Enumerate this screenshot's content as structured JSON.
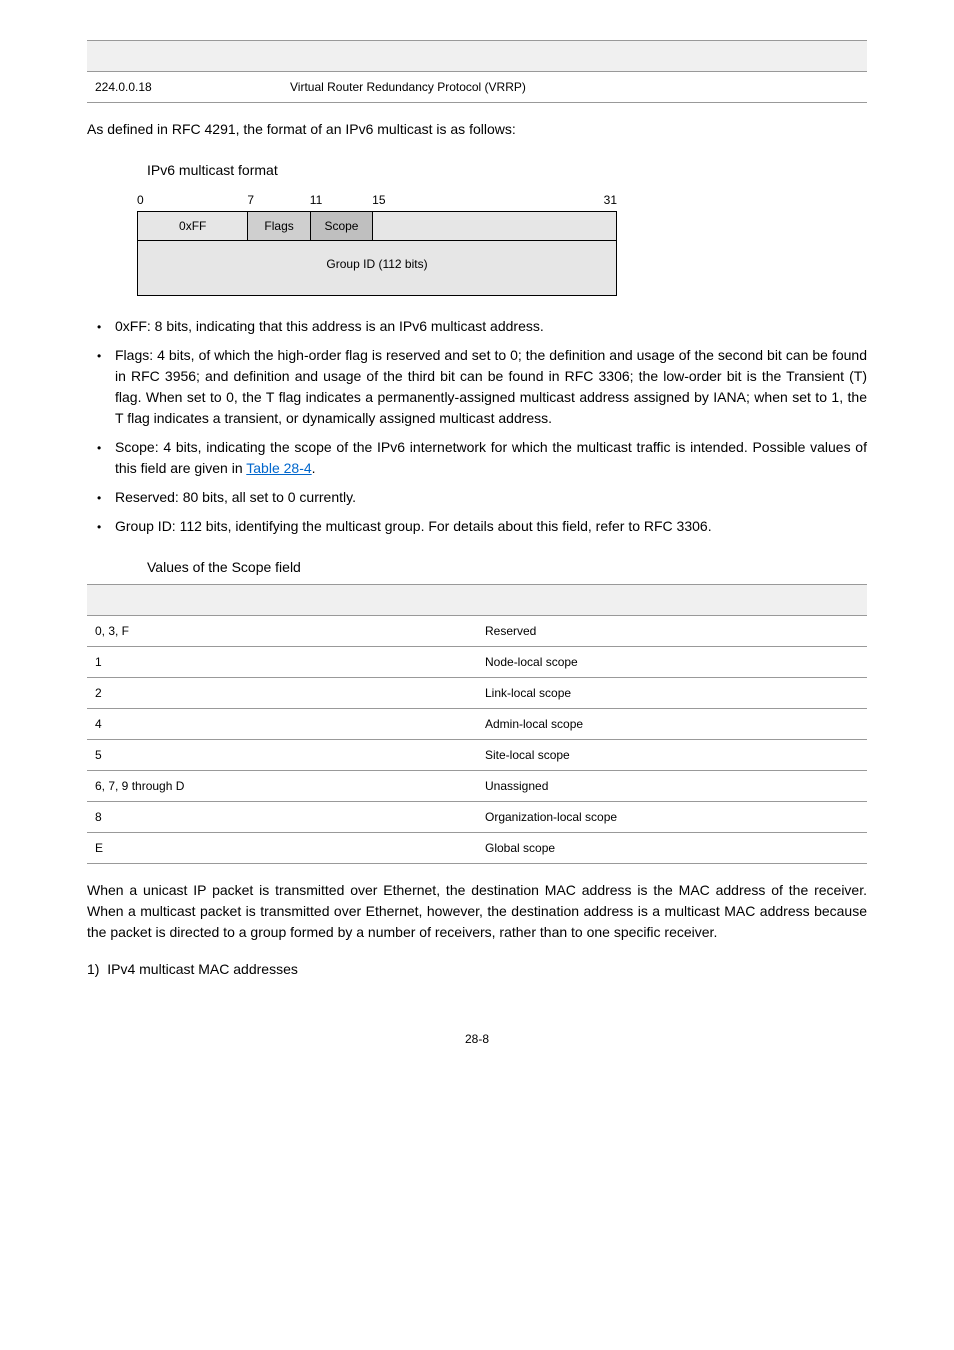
{
  "top_table": {
    "col1": "224.0.0.18",
    "col2": "Virtual Router Redundancy Protocol (VRRP)"
  },
  "intro": "As defined in RFC 4291, the format of an IPv6 multicast is as follows:",
  "diagram_caption": "IPv6 multicast format",
  "diagram": {
    "bits": {
      "b0": "0",
      "b7": "7",
      "b11": "11",
      "b15": "15",
      "b31": "31"
    },
    "ff": "0xFF",
    "flags": "Flags",
    "scope": "Scope",
    "group": "Group ID (112 bits)"
  },
  "bullets": [
    "0xFF: 8 bits, indicating that this address is an IPv6 multicast address.",
    "Flags: 4 bits, of which the high-order flag is reserved and set to 0; the definition and usage of the second bit can be found in RFC 3956; and definition and usage of the third bit can be found in RFC 3306; the low-order bit is the Transient (T) flag. When set to 0, the T flag indicates a permanently-assigned multicast address assigned by IANA; when set to 1, the T flag indicates a transient, or dynamically assigned multicast address.",
    "Scope: 4 bits, indicating the scope of the IPv6 internetwork for which the multicast traffic is intended. Possible values of this field are given in ",
    "Reserved: 80 bits, all set to 0 currently.",
    "Group ID: 112 bits, identifying the multicast group. For details about this field, refer to RFC 3306."
  ],
  "table_ref": "Table 28-4",
  "scope_caption": "Values of the Scope field",
  "scope_table": [
    {
      "v": "0, 3, F",
      "m": "Reserved"
    },
    {
      "v": "1",
      "m": "Node-local scope"
    },
    {
      "v": "2",
      "m": "Link-local scope"
    },
    {
      "v": "4",
      "m": "Admin-local scope"
    },
    {
      "v": "5",
      "m": "Site-local scope"
    },
    {
      "v": "6, 7, 9 through D",
      "m": "Unassigned"
    },
    {
      "v": "8",
      "m": "Organization-local scope"
    },
    {
      "v": "E",
      "m": "Global scope"
    }
  ],
  "para2": "When a unicast IP packet is transmitted over Ethernet, the destination MAC address is the MAC address of the receiver. When a multicast packet is transmitted over Ethernet, however, the destination address is a multicast MAC address because the packet is directed to a group formed by a number of receivers, rather than to one specific receiver.",
  "list1_num": "1)",
  "list1_text": "IPv4 multicast MAC addresses",
  "page_num": "28-8"
}
